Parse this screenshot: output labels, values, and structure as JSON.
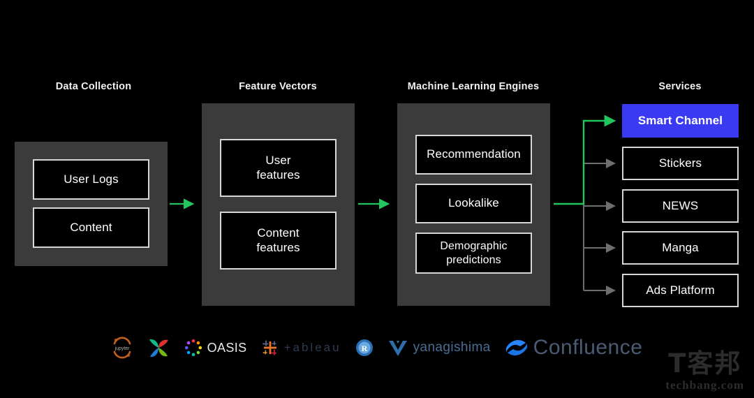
{
  "diagram": {
    "background_color": "#000000",
    "panel_color": "#3b3b3b",
    "node_border_color": "#d6d6d6",
    "highlight_color": "#3a3af2",
    "active_wire_color": "#22c55e",
    "inactive_wire_color": "#6e6e6e"
  },
  "columns": [
    {
      "id": "data-collection",
      "title": "Data Collection"
    },
    {
      "id": "feature-vectors",
      "title": "Feature Vectors"
    },
    {
      "id": "ml-engines",
      "title": "Machine Learning Engines"
    },
    {
      "id": "services",
      "title": "Services"
    }
  ],
  "data_collection": {
    "title": "Data Collection",
    "nodes": [
      {
        "label": "User Logs"
      },
      {
        "label": "Content"
      }
    ]
  },
  "feature_vectors": {
    "title": "Feature Vectors",
    "nodes": [
      {
        "label": "User\nfeatures"
      },
      {
        "label": "Content\nfeatures"
      }
    ]
  },
  "ml_engines": {
    "title": "Machine Learning Engines",
    "nodes": [
      {
        "label": "Recommendation"
      },
      {
        "label": "Lookalike"
      },
      {
        "label": "Demographic\npredictions"
      }
    ]
  },
  "services": {
    "title": "Services",
    "nodes": [
      {
        "label": "Smart Channel",
        "highlighted": true
      },
      {
        "label": "Stickers",
        "highlighted": false
      },
      {
        "label": "NEWS",
        "highlighted": false
      },
      {
        "label": "Manga",
        "highlighted": false
      },
      {
        "label": "Ads Platform",
        "highlighted": false
      }
    ]
  },
  "logos": [
    {
      "name": "jupyter-logo",
      "text": ""
    },
    {
      "name": "airflow-logo",
      "text": ""
    },
    {
      "name": "oasis-logo",
      "text": "OASIS"
    },
    {
      "name": "tableau-logo",
      "text": "+ableau"
    },
    {
      "name": "r-logo",
      "text": ""
    },
    {
      "name": "yanagishima-logo",
      "text": "yanagishima"
    },
    {
      "name": "confluence-logo",
      "text": "Confluence"
    }
  ],
  "watermark": {
    "chinese": "T客邦",
    "latin": "techbang.com"
  }
}
